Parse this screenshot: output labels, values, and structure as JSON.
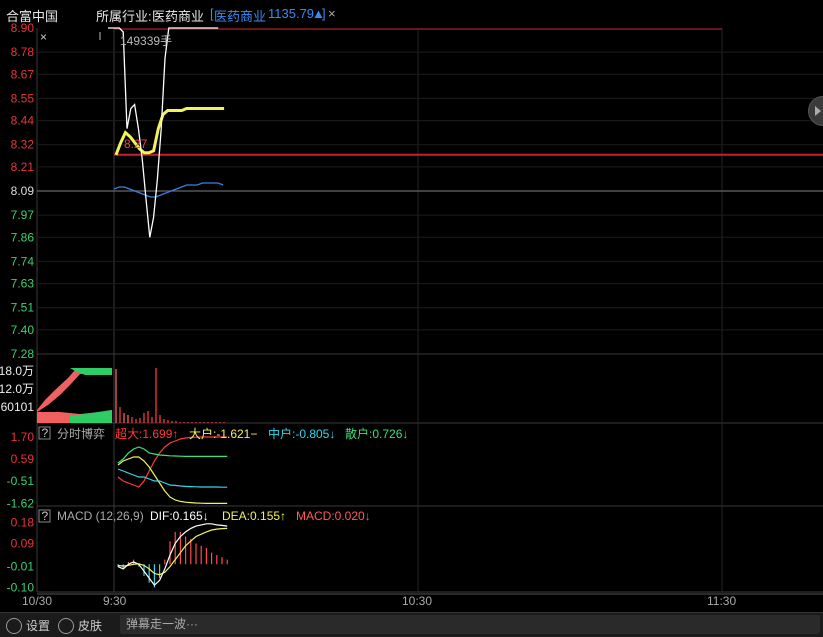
{
  "header": {
    "stock_name": "合富中国",
    "industry_label": "所属行业:",
    "industry_name": "医药商业",
    "index_name": "医药商业",
    "index_value": "1135.79",
    "index_arrow": "▲",
    "close_glyph": "×"
  },
  "price_panel": {
    "y_ticks": [
      "8.90",
      "8.78",
      "8.67",
      "8.55",
      "8.44",
      "8.32",
      "8.21",
      "8.09",
      "7.97",
      "7.86",
      "7.74",
      "7.63",
      "7.51",
      "7.40",
      "7.28"
    ],
    "prev_close": 8.09,
    "ref_line_label": "8.27",
    "cursor_volume": "149339手",
    "corner_glyph": "×",
    "price_series": [
      8.9,
      8.9,
      8.9,
      8.9,
      8.88,
      8.4,
      8.5,
      8.52,
      8.4,
      8.25,
      8.05,
      7.86,
      7.96,
      8.15,
      8.4,
      8.75,
      8.9,
      8.9,
      8.9,
      8.9,
      8.9,
      8.9,
      8.9,
      8.9,
      8.9,
      8.9,
      8.9,
      8.9,
      8.9,
      8.9
    ],
    "avg_series": [
      8.1,
      8.11,
      8.11,
      8.1,
      8.09,
      8.08,
      8.07,
      8.06,
      8.06,
      8.07,
      8.08,
      8.09,
      8.1,
      8.11,
      8.12,
      8.12,
      8.12,
      8.13,
      8.13,
      8.13,
      8.13,
      8.12
    ],
    "index_series": [
      8.27,
      8.33,
      8.38,
      8.36,
      8.33,
      8.3,
      8.28,
      8.28,
      8.29,
      8.4,
      8.47,
      8.49,
      8.49,
      8.49,
      8.49,
      8.5,
      8.5,
      8.5,
      8.5,
      8.5,
      8.5,
      8.5,
      8.5,
      8.5
    ]
  },
  "volume_panel": {
    "y_ticks": [
      "18.0万",
      "12.0万",
      "60101"
    ]
  },
  "fund_panel": {
    "help_icon": "?",
    "title": "分时博弈",
    "legend": [
      {
        "label": "超大:1.699↑",
        "color": "#ff3a3a"
      },
      {
        "label": "大户:-1.621−",
        "color": "#f2f25a"
      },
      {
        "label": "中户:-0.805↓",
        "color": "#36d6e8"
      },
      {
        "label": "散户:0.726↓",
        "color": "#3de07a"
      }
    ],
    "y_ticks": [
      "1.70",
      "0.59",
      "-0.51",
      "-1.62"
    ],
    "series": {
      "super": [
        -0.3,
        -0.5,
        -0.6,
        -0.7,
        -0.8,
        -0.5,
        0.0,
        0.5,
        0.9,
        1.2,
        1.4,
        1.5,
        1.6,
        1.65,
        1.68,
        1.69,
        1.7,
        1.7,
        1.7,
        1.7,
        1.7,
        1.7
      ],
      "large": [
        0.3,
        0.5,
        0.6,
        0.7,
        0.7,
        0.5,
        0.2,
        -0.2,
        -0.6,
        -1.0,
        -1.3,
        -1.45,
        -1.52,
        -1.56,
        -1.58,
        -1.6,
        -1.61,
        -1.62,
        -1.62,
        -1.62,
        -1.62,
        -1.62
      ],
      "mid": [
        0.1,
        0.0,
        -0.1,
        -0.2,
        -0.3,
        -0.3,
        -0.4,
        -0.5,
        -0.5,
        -0.6,
        -0.7,
        -0.72,
        -0.75,
        -0.77,
        -0.78,
        -0.79,
        -0.8,
        -0.8,
        -0.8,
        -0.8,
        -0.81,
        -0.81
      ],
      "retail": [
        0.4,
        0.6,
        0.9,
        1.1,
        1.2,
        1.1,
        0.9,
        0.85,
        0.8,
        0.78,
        0.76,
        0.75,
        0.74,
        0.73,
        0.73,
        0.73,
        0.73,
        0.73,
        0.73,
        0.73,
        0.73,
        0.73
      ]
    }
  },
  "macd_panel": {
    "help_icon": "?",
    "title": "MACD (12,26,9)",
    "legend": [
      {
        "label": "DIF:0.165↓",
        "color": "#ffffff"
      },
      {
        "label": "DEA:0.155↑",
        "color": "#f2f25a"
      },
      {
        "label": "MACD:0.020↓",
        "color": "#ff5a5a"
      }
    ],
    "y_ticks": [
      "0.18",
      "0.09",
      "-0.01",
      "-0.10"
    ],
    "dif": [
      -0.01,
      -0.02,
      0.0,
      0.01,
      0.0,
      -0.03,
      -0.06,
      -0.09,
      -0.07,
      -0.02,
      0.04,
      0.09,
      0.12,
      0.14,
      0.155,
      0.165,
      0.17,
      0.175,
      0.175,
      0.17,
      0.168,
      0.165
    ],
    "dea": [
      -0.005,
      -0.008,
      -0.005,
      0.0,
      0.002,
      -0.005,
      -0.02,
      -0.04,
      -0.045,
      -0.035,
      -0.01,
      0.02,
      0.05,
      0.08,
      0.1,
      0.12,
      0.13,
      0.14,
      0.148,
      0.152,
      0.154,
      0.155
    ],
    "hist": [
      -0.01,
      -0.02,
      0.01,
      0.02,
      -0.01,
      -0.05,
      -0.08,
      -0.1,
      -0.06,
      0.02,
      0.1,
      0.14,
      0.14,
      0.12,
      0.11,
      0.09,
      0.08,
      0.07,
      0.05,
      0.04,
      0.03,
      0.02
    ]
  },
  "time_axis": {
    "labels": [
      "10/30",
      "9:30",
      "10:30",
      "11:30"
    ]
  },
  "bottom_bar": {
    "settings_label": "设置",
    "skin_label": "皮肤",
    "danmu_placeholder": "弹幕走一波···"
  },
  "colors": {
    "up": "#e8343a",
    "down": "#3bd16f",
    "price_line": "#ffffff",
    "index_line": "#f2f25a",
    "avg_line": "#3a7fe0",
    "prev_close_line": "#cc1f2a"
  }
}
